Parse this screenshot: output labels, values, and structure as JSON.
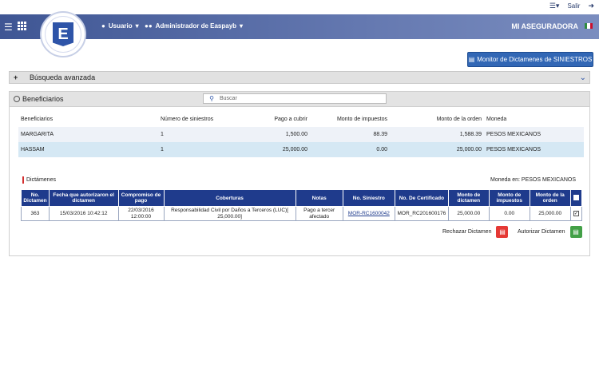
{
  "topbar": {
    "logout_label": "Salir"
  },
  "navbar": {
    "user_label": "Usuario",
    "admin_label": "Administrador de Easpayb",
    "brand": "MI ASEGURADORA",
    "logo_letter": "E"
  },
  "monitor_button": "Monitor de Dictamenes de SINIESTROS",
  "advanced_search": {
    "label": "Búsqueda avanzada",
    "toggle": "+"
  },
  "beneficiarios": {
    "title": "Beneficiarios",
    "search_placeholder": "Buscar",
    "columns": [
      "Beneficiarios",
      "Número de siniestros",
      "Pago a cubrir",
      "Monto de impuestos",
      "Monto de la orden",
      "Moneda"
    ],
    "rows": [
      {
        "name": "MARGARITA",
        "siniestros": "1",
        "pago": "1,500.00",
        "impuestos": "88.39",
        "orden": "1,588.39",
        "moneda": "PESOS MEXICANOS"
      },
      {
        "name": "HASSAM",
        "siniestros": "1",
        "pago": "25,000.00",
        "impuestos": "0.00",
        "orden": "25,000.00",
        "moneda": "PESOS MEXICANOS"
      }
    ]
  },
  "dictamenes": {
    "title": "Dictámenes",
    "moneda_label": "Moneda en: PESOS MEXICANOS",
    "columns": [
      "No. Dictamen",
      "Fecha que autorizaron el dictamen",
      "Compromiso de pago",
      "Coberturas",
      "Notas",
      "No. Siniestro",
      "No. De Certificado",
      "Monto de dictamen",
      "Monto de impuestos",
      "Monto de la orden"
    ],
    "rows": [
      {
        "no": "363",
        "fecha": "15/03/2016 10:42:12",
        "compromiso": "22/03/2016 12:00:00",
        "coberturas": "Responsabilidad Civil por Daños a Terceros (LUC)[ 25,000.00]",
        "notas": "Pago a tercer afectado",
        "siniestro": "MOR-RC1600042",
        "certificado": "MOR_RC201600176",
        "monto_dictamen": "25,000.00",
        "monto_impuestos": "0.00",
        "monto_orden": "25,000.00",
        "checked": true
      }
    ],
    "reject_label": "Rechazar Dictamen",
    "authorize_label": "Autorizar Dictamen"
  },
  "colors": {
    "header_blue": "#1f3b8c",
    "reject_red": "#e53935",
    "authorize_green": "#43a047"
  }
}
